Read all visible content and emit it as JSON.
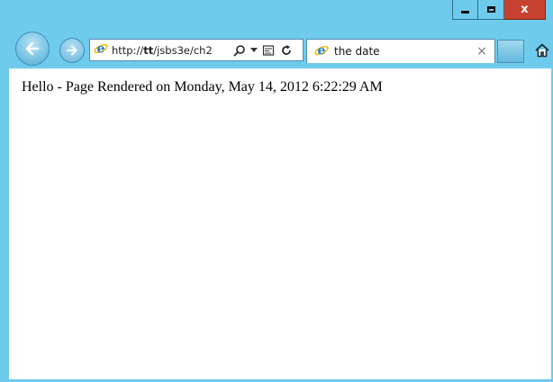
{
  "browser": {
    "address_url_prefix": "http://",
    "address_url_host": "tt",
    "address_url_rest": "/jsbs3e/ch2",
    "tab_title": "the date",
    "tab_close_glyph": "×",
    "caption_close_glyph": "x",
    "icons": {
      "back": "back-arrow-icon",
      "forward": "forward-arrow-icon",
      "site": "ie-logo-icon",
      "search": "search-icon",
      "compat": "compatibility-view-icon",
      "refresh": "refresh-icon",
      "home": "home-icon"
    },
    "colors": {
      "frame": "#6ecbec",
      "close_button": "#c7412f"
    }
  },
  "page": {
    "text": "Hello - Page Rendered on Monday, May 14, 2012 6:22:29 AM"
  }
}
